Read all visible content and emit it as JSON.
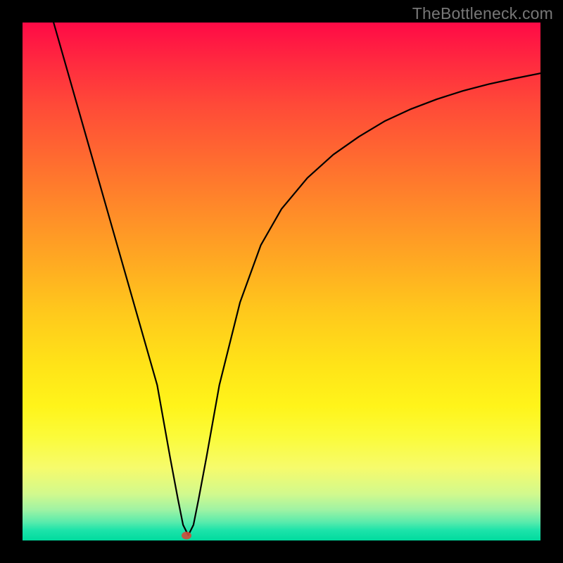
{
  "watermark": "TheBottleneck.com",
  "chart_data": {
    "type": "line",
    "title": "",
    "xlabel": "",
    "ylabel": "",
    "xlim": [
      0,
      100
    ],
    "ylim": [
      0,
      100
    ],
    "grid": false,
    "series": [
      {
        "name": "curve",
        "x": [
          6,
          10,
          14,
          18,
          22,
          26,
          28.5,
          30,
          31,
          32,
          33,
          34,
          35.5,
          38,
          42,
          46,
          50,
          55,
          60,
          65,
          70,
          75,
          80,
          85,
          90,
          95,
          100
        ],
        "y": [
          100,
          86,
          72,
          58,
          44,
          30,
          16,
          8,
          3,
          1,
          3,
          8,
          16,
          30,
          46,
          57,
          64,
          70,
          74.5,
          78,
          81,
          83.3,
          85.2,
          86.8,
          88.1,
          89.2,
          90.2
        ]
      }
    ],
    "marker": {
      "x_pct": 31.7,
      "y_pct": 99.0
    }
  }
}
